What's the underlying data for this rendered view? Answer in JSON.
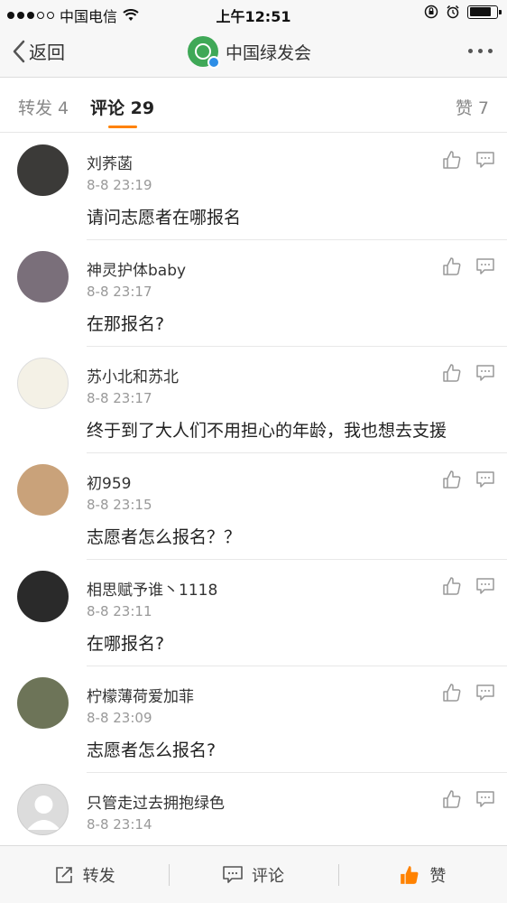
{
  "status_bar": {
    "carrier": "中国电信",
    "time": "上午12:51"
  },
  "nav": {
    "back_label": "返回",
    "title": "中国绿发会"
  },
  "tabs": [
    {
      "label": "转发 4",
      "active": false
    },
    {
      "label": "评论 29",
      "active": true
    },
    {
      "label": "赞 7",
      "active": false
    }
  ],
  "comments": [
    {
      "name": "刘荞菡",
      "time": "8-8 23:19",
      "text": "请问志愿者在哪报名",
      "avatar_color": "#3b3a38"
    },
    {
      "name": "神灵护体baby",
      "time": "8-8 23:17",
      "text": "在那报名?",
      "avatar_color": "#7a6f7a"
    },
    {
      "name": "苏小北和苏北",
      "time": "8-8 23:17",
      "text": "终于到了大人们不用担心的年龄，我也想去支援",
      "avatar_color": "#f4f1e6"
    },
    {
      "name": "初959",
      "time": "8-8 23:15",
      "text": "志愿者怎么报名？？",
      "avatar_color": "#c9a27a"
    },
    {
      "name": "相思赋予谁丶1118",
      "time": "8-8 23:11",
      "text": "在哪报名?",
      "avatar_color": "#2a2a2a"
    },
    {
      "name": "柠檬薄荷爱加菲",
      "time": "8-8 23:09",
      "text": "志愿者怎么报名?",
      "avatar_color": "#6d7458"
    },
    {
      "name": "只管走过去拥抱绿色",
      "time": "8-8 23:14",
      "text": "",
      "avatar_color": "#dcdcdc"
    }
  ],
  "bottom_bar": {
    "repost_label": "转发",
    "comment_label": "评论",
    "like_label": "赞"
  },
  "colors": {
    "accent": "#ff8200",
    "brand_green": "#3fa857"
  }
}
